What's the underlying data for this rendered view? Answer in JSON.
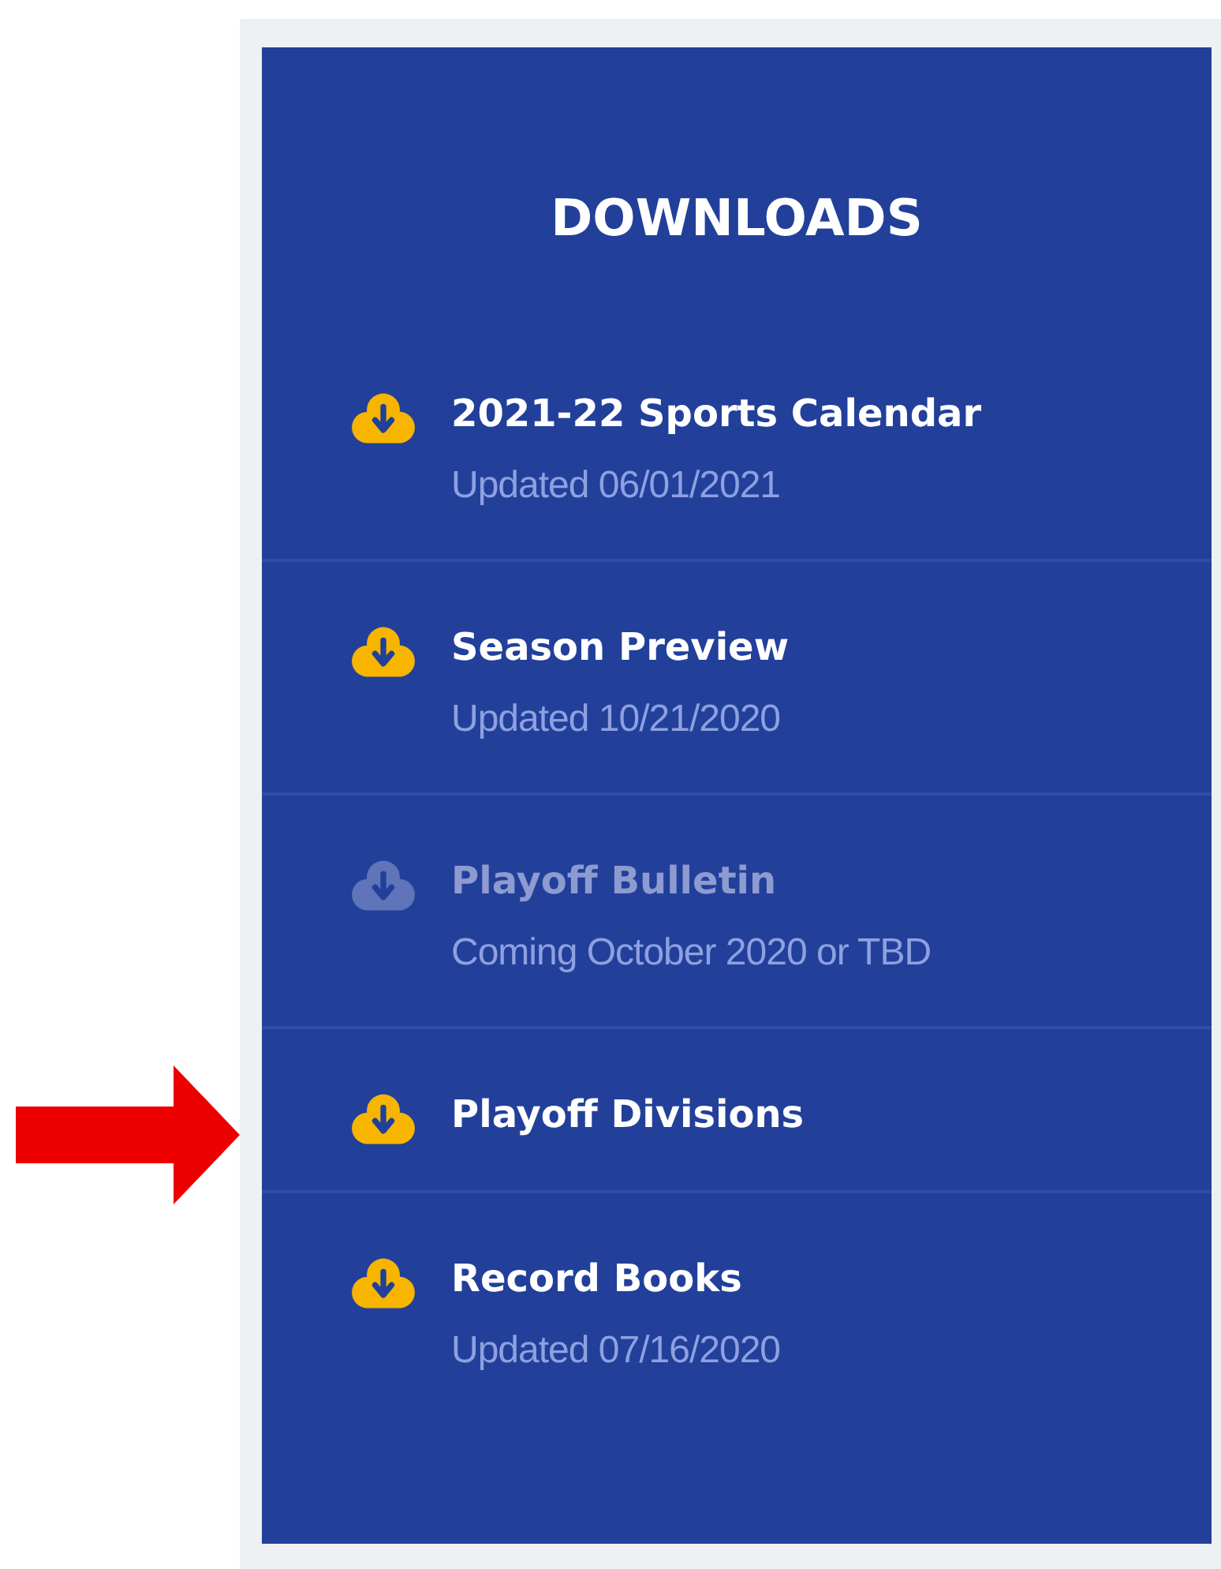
{
  "panel": {
    "title": "DOWNLOADS",
    "items": [
      {
        "title": "2021-22 Sports Calendar",
        "subtitle": "Updated 06/01/2021",
        "disabled": false
      },
      {
        "title": "Season Preview",
        "subtitle": "Updated 10/21/2020",
        "disabled": false
      },
      {
        "title": "Playoff Bulletin",
        "subtitle": "Coming October 2020 or TBD",
        "disabled": true
      },
      {
        "title": "Playoff Divisions",
        "disabled": false
      },
      {
        "title": "Record Books",
        "subtitle": "Updated 07/16/2020",
        "disabled": false
      }
    ]
  }
}
